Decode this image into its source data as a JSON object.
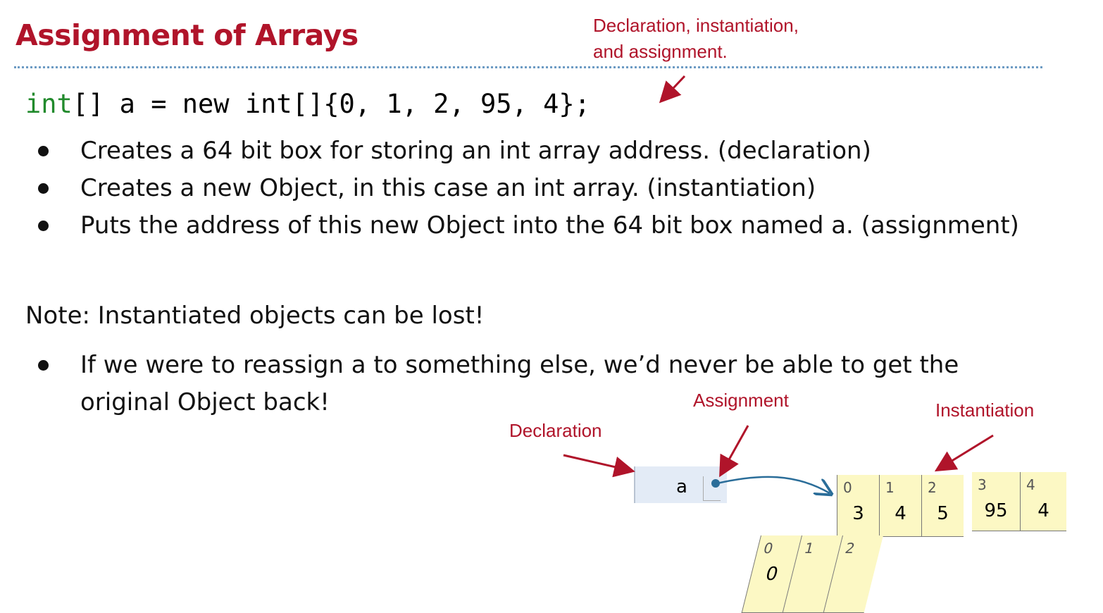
{
  "title": "Assignment of Arrays",
  "top_annotation": {
    "line1": "Declaration, instantiation,",
    "line2": "and assignment."
  },
  "code": {
    "keyword": "int",
    "rest": "[] a = new int[]{0, 1, 2, 95, 4};"
  },
  "bullets": [
    "Creates a 64 bit box for storing an int array address. (declaration)",
    "Creates a new Object, in this case an int array. (instantiation)",
    "Puts the address of this new Object into the 64 bit box named a. (assignment)"
  ],
  "note": "Note: Instantiated objects can be lost!",
  "note_bullet": {
    "line1": "If we were to reassign a to something else, we’d never be able to get the",
    "line2": "original Object back!"
  },
  "diagram": {
    "labels": {
      "declaration": "Declaration",
      "assignment": "Assignment",
      "instantiation": "Instantiation"
    },
    "variable_name": "a",
    "array_front": {
      "indices": [
        "0",
        "1",
        "2"
      ],
      "values": [
        "3",
        "4",
        "5"
      ]
    },
    "array_back": {
      "indices": [
        "3",
        "4"
      ],
      "values": [
        "95",
        "4"
      ]
    },
    "array_skewed": {
      "indices": [
        "0",
        "1",
        "2"
      ],
      "values": [
        "0",
        "",
        ""
      ]
    },
    "colors": {
      "accent_red": "#b0142a",
      "code_keyword": "#218a2c",
      "divider": "#6d9bc3",
      "frame_bg": "#e3ebf6",
      "array_bg": "#fcf8c4",
      "pointer": "#2a6d99"
    }
  }
}
